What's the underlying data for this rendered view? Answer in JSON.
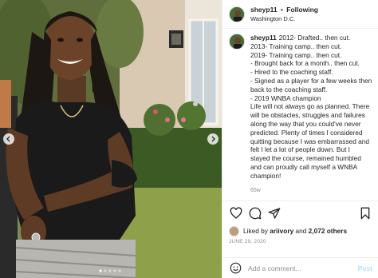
{
  "header": {
    "username": "sheyp11",
    "separator": "•",
    "follow_label": "Following",
    "location": "Washington D.C."
  },
  "caption": {
    "username": "sheyp11",
    "lines": [
      "2012- Drafted.. then cut.",
      "2013- Training camp.. then cut.",
      "2019- Training camp.. then cut.",
      "- Brought back for a month.. then cut.",
      "- Hired to the coaching staff.",
      "- Signed as a player for a few weeks then",
      "back to the coaching staff.",
      "- 2019 WNBA champion",
      "Life will not always go as planned. There",
      "will be obstacles, struggles and failures",
      "along the way that you could've never",
      "predicted. Plenty of times I considered",
      "quitting because I was embarrassed and",
      "felt I let a lot of people down. But I",
      "stayed the course, remained humbled",
      "and can proudly call myself a WNBA",
      "champion!"
    ],
    "time_ago": "65w"
  },
  "likes": {
    "prefix": "Liked by",
    "liker": "ariivory",
    "connector": "and",
    "count": "2,072 others"
  },
  "date": "JUNE 29, 2020",
  "comment": {
    "placeholder": "Add a comment...",
    "post_label": "Post"
  },
  "colors": {
    "accent": "#0095f6",
    "post_disabled": "#b2dffc",
    "border": "#efefef",
    "muted": "#8e8e8e"
  },
  "icons": [
    "chevron-left-icon",
    "chevron-right-icon",
    "heart-icon",
    "comment-icon",
    "share-icon",
    "bookmark-icon",
    "emoji-icon"
  ]
}
